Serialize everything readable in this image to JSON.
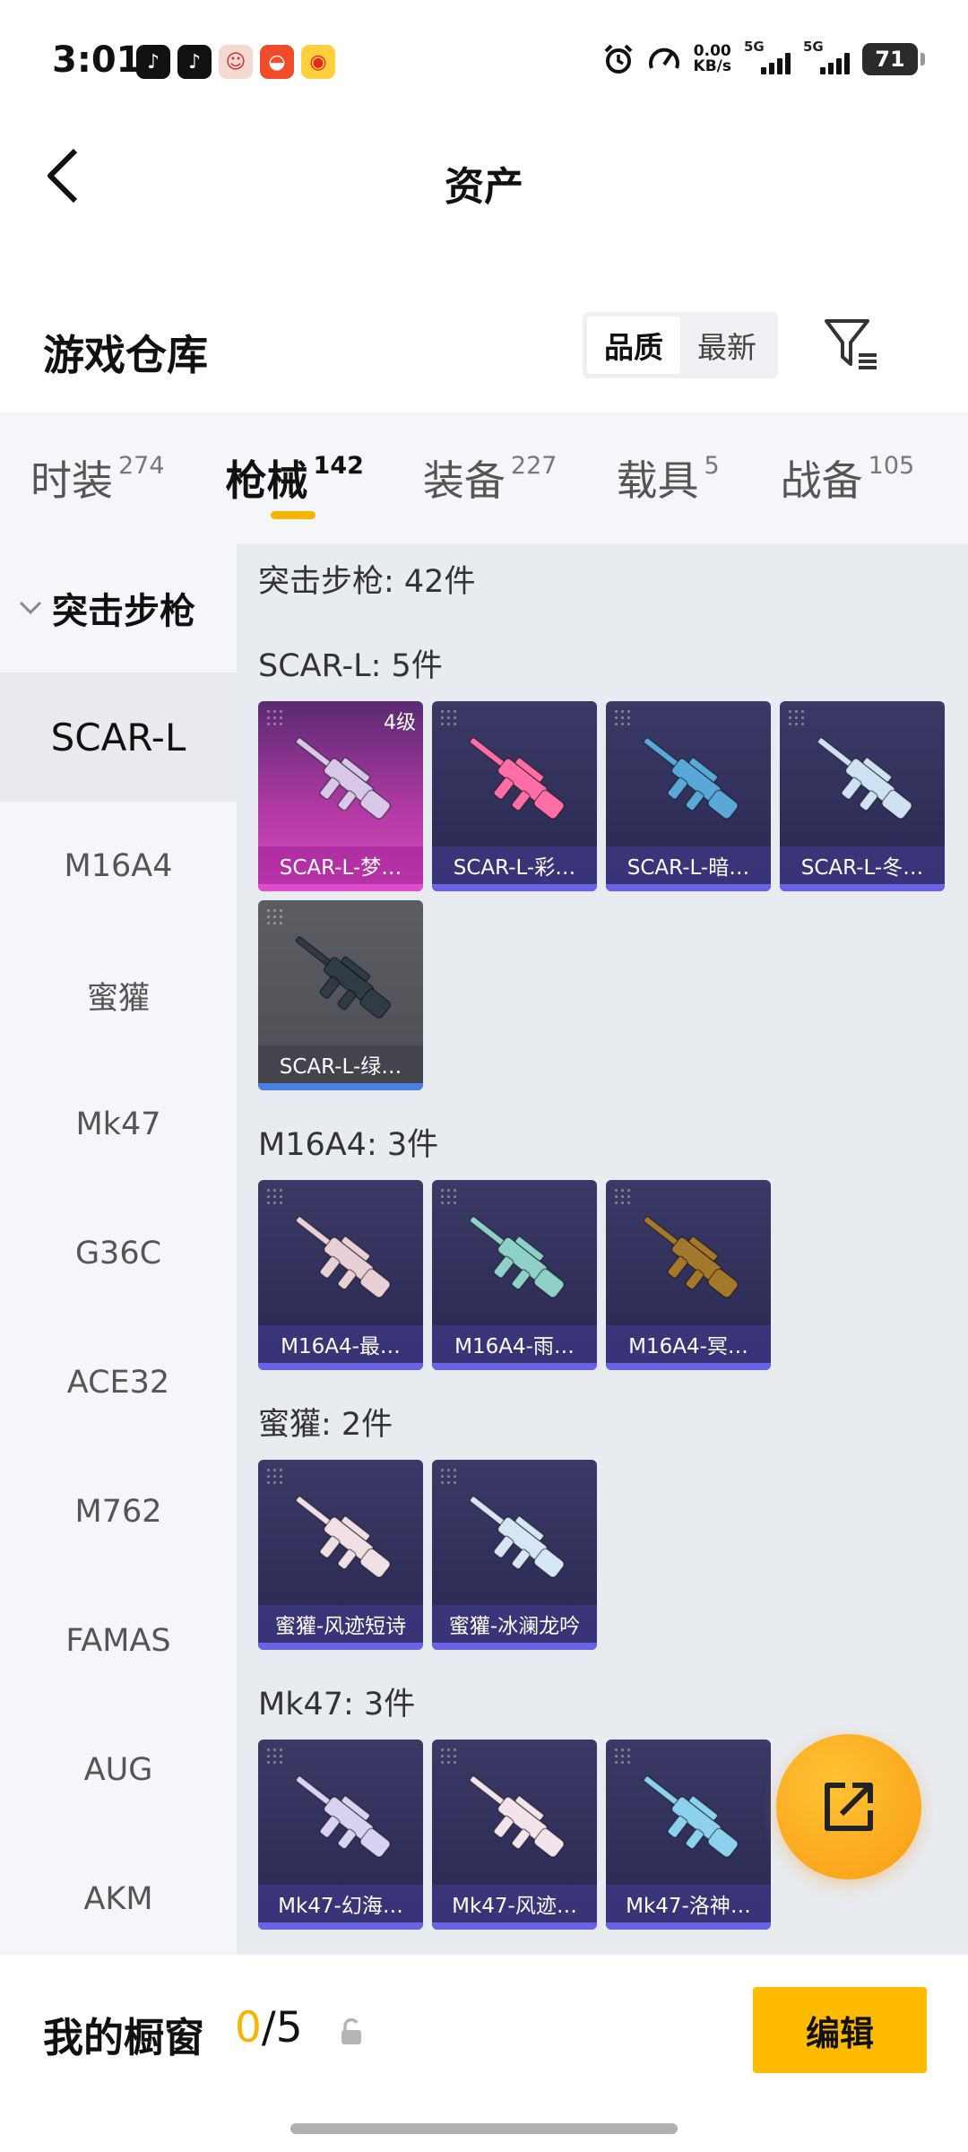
{
  "status_bar": {
    "time": "3:01",
    "net_speed_value": "0.00",
    "net_speed_unit": "KB/s",
    "sim1": "5G",
    "sim2": "5G",
    "battery": "71"
  },
  "header": {
    "title": "资产"
  },
  "warehouse": {
    "title": "游戏仓库",
    "sort_options": [
      "品质",
      "最新"
    ],
    "sort_selected": "品质"
  },
  "tabs": [
    {
      "label": "时装",
      "count": "274"
    },
    {
      "label": "枪械",
      "count": "142"
    },
    {
      "label": "装备",
      "count": "227"
    },
    {
      "label": "载具",
      "count": "5"
    },
    {
      "label": "战备",
      "count": "105"
    }
  ],
  "sidebar": {
    "group_label": "突击步枪",
    "items": [
      "SCAR-L",
      "M16A4",
      "蜜獾",
      "Mk47",
      "G36C",
      "ACE32",
      "M762",
      "FAMAS",
      "AUG",
      "AKM"
    ]
  },
  "content": {
    "summary": "突击步枪: 42件",
    "sections": [
      {
        "title": "SCAR-L: 5件",
        "items": [
          {
            "name": "SCAR-L-梦…",
            "level": "4级",
            "rarity": "pink",
            "gun_color": "#d8c7e8"
          },
          {
            "name": "SCAR-L-彩…",
            "rarity": "purple",
            "gun_color": "#ff6fa6"
          },
          {
            "name": "SCAR-L-暗…",
            "rarity": "purple",
            "gun_color": "#5aa8d8"
          },
          {
            "name": "SCAR-L-冬…",
            "rarity": "purple",
            "gun_color": "#cfe2f3"
          },
          {
            "name": "SCAR-L-绿…",
            "rarity": "gray",
            "gun_color": "#2f3b45"
          }
        ]
      },
      {
        "title": "M16A4: 3件",
        "items": [
          {
            "name": "M16A4-最…",
            "rarity": "purple",
            "gun_color": "#e9cfd6"
          },
          {
            "name": "M16A4-雨…",
            "rarity": "purple",
            "gun_color": "#8fd0c8"
          },
          {
            "name": "M16A4-冥…",
            "rarity": "purple",
            "gun_color": "#a4782c"
          }
        ]
      },
      {
        "title": "蜜獾: 2件",
        "items": [
          {
            "name": "蜜獾-风迹短诗",
            "rarity": "purple",
            "gun_color": "#f1dfe6"
          },
          {
            "name": "蜜獾-冰澜龙吟",
            "rarity": "purple",
            "gun_color": "#d7e6f5"
          }
        ]
      },
      {
        "title": "Mk47: 3件",
        "items": [
          {
            "name": "Mk47-幻海…",
            "rarity": "purple",
            "gun_color": "#d9d2f2"
          },
          {
            "name": "Mk47-风迹…",
            "rarity": "purple",
            "gun_color": "#f3e3ea"
          },
          {
            "name": "Mk47-洛神…",
            "rarity": "purple",
            "gun_color": "#8dd1ee"
          }
        ]
      }
    ]
  },
  "bottom_bar": {
    "showcase_label": "我的橱窗",
    "showcase_used": "0",
    "showcase_total": "/5",
    "edit_label": "编辑"
  },
  "colors": {
    "accent": "#f7b500",
    "edit_button": "#ffbb00",
    "fab": "#fba81e"
  }
}
